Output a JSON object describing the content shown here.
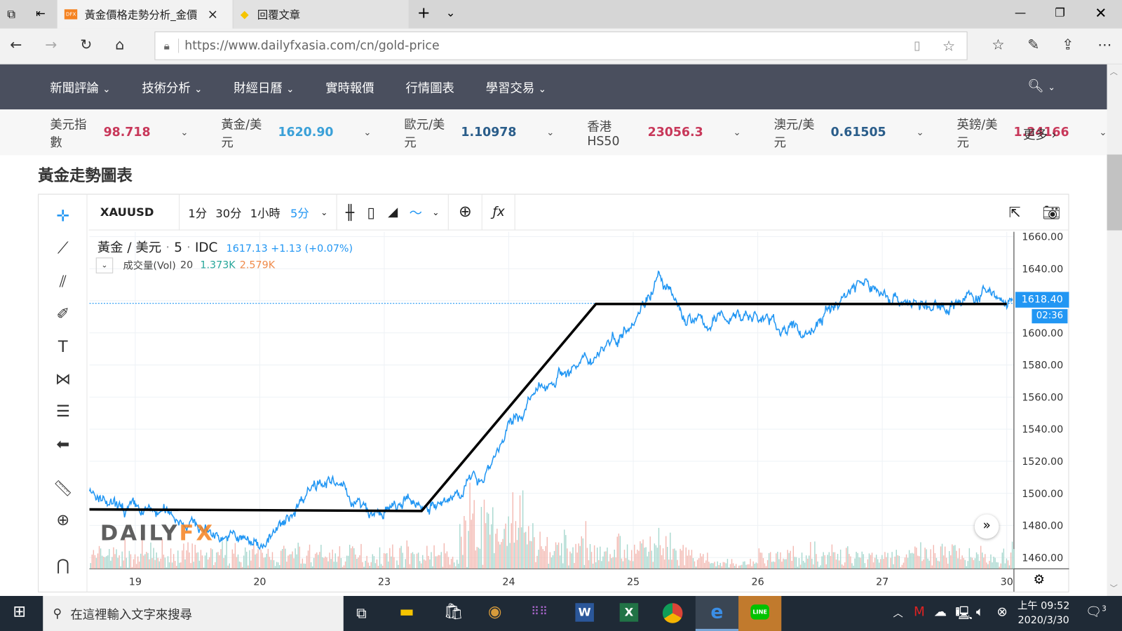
{
  "browser": {
    "tabs": [
      {
        "label": "黃金價格走勢分析_金價",
        "icon": "dfx-favicon"
      },
      {
        "label": "回覆文章",
        "icon": "diamond-favicon"
      }
    ],
    "url": "https://www.dailyfxasia.com/cn/gold-price"
  },
  "nav": {
    "items": [
      "新聞評論",
      "技術分析",
      "財經日曆",
      "實時報價",
      "行情圖表",
      "學習交易"
    ],
    "dropdowns": [
      true,
      true,
      true,
      false,
      false,
      true
    ]
  },
  "ticker": {
    "items": [
      {
        "name": "美元指數",
        "value": "98.718",
        "color": "#c8385a"
      },
      {
        "name": "黃金/美元",
        "value": "1620.90",
        "color": "#3aa0d8"
      },
      {
        "name": "歐元/美元",
        "value": "1.10978",
        "color": "#2a5d8a"
      },
      {
        "name": "香港HS50",
        "value": "23056.3",
        "color": "#c8385a"
      },
      {
        "name": "澳元/美元",
        "value": "0.61505",
        "color": "#2a5d8a"
      },
      {
        "name": "英鎊/美元",
        "value": "1.24166",
        "color": "#c8385a"
      }
    ],
    "more": "更多"
  },
  "page_title": "黃金走勢圖表",
  "chart": {
    "symbol": "XAUUSD",
    "intervals": [
      "1分",
      "30分",
      "1小時",
      "5分"
    ],
    "legend_title": "黃金 / 美元",
    "legend_sep": "·",
    "legend_interval": "5",
    "legend_source": "IDC",
    "legend_quote": "1617.13 +1.13 (+0.07%)",
    "vol_label": "成交量(Vol)",
    "vol_len": "20",
    "vol_a": "1.373K",
    "vol_b": "2.579K",
    "last_price": "1618.40",
    "countdown": "02:36",
    "watermark": "DAILYFX"
  },
  "chart_data": {
    "type": "line",
    "title": "黃金 / 美元 · 5 · IDC",
    "xlabel": "",
    "ylabel": "",
    "categories": [
      "19",
      "20",
      "23",
      "24",
      "25",
      "26",
      "27",
      "30"
    ],
    "y_ticks": [
      "1660.00",
      "1640.00",
      "1620.00",
      "1600.00",
      "1580.00",
      "1560.00",
      "1540.00",
      "1520.00",
      "1500.00",
      "1480.00",
      "1460.00"
    ],
    "ylim": [
      1453,
      1663
    ],
    "series": [
      {
        "name": "XAUUSD",
        "color": "#2196f3",
        "points": [
          [
            -0.37,
            1500
          ],
          [
            -0.2,
            1490
          ],
          [
            0.3,
            1487
          ],
          [
            0.6,
            1476
          ],
          [
            1.0,
            1468
          ],
          [
            1.2,
            1480
          ],
          [
            1.4,
            1505
          ],
          [
            1.5,
            1510
          ],
          [
            1.7,
            1500
          ],
          [
            1.9,
            1485
          ],
          [
            2.0,
            1488
          ],
          [
            2.2,
            1494
          ],
          [
            2.5,
            1492
          ],
          [
            2.6,
            1503
          ],
          [
            2.8,
            1512
          ],
          [
            3.0,
            1540
          ],
          [
            3.2,
            1560
          ],
          [
            3.4,
            1575
          ],
          [
            3.6,
            1580
          ],
          [
            3.8,
            1595
          ],
          [
            3.9,
            1600
          ],
          [
            4.1,
            1622
          ],
          [
            4.2,
            1635
          ],
          [
            4.4,
            1610
          ],
          [
            4.6,
            1605
          ],
          [
            4.8,
            1612
          ],
          [
            5.0,
            1610
          ],
          [
            5.2,
            1603
          ],
          [
            5.4,
            1600
          ],
          [
            5.6,
            1615
          ],
          [
            5.8,
            1632
          ],
          [
            6.0,
            1625
          ],
          [
            6.2,
            1620
          ],
          [
            6.4,
            1614
          ],
          [
            6.6,
            1620
          ],
          [
            6.9,
            1625
          ],
          [
            7.0,
            1618
          ]
        ]
      },
      {
        "name": "trendline",
        "color": "#000000",
        "points": [
          [
            -0.37,
            1490
          ],
          [
            2.3,
            1489
          ],
          [
            3.7,
            1618
          ],
          [
            7.0,
            1618
          ]
        ]
      }
    ],
    "last_price": 1618.4
  },
  "taskbar": {
    "search_placeholder": "在這裡輸入文字來搜尋",
    "time": "上午 09:52",
    "date": "2020/3/30",
    "notif_count": "3"
  }
}
